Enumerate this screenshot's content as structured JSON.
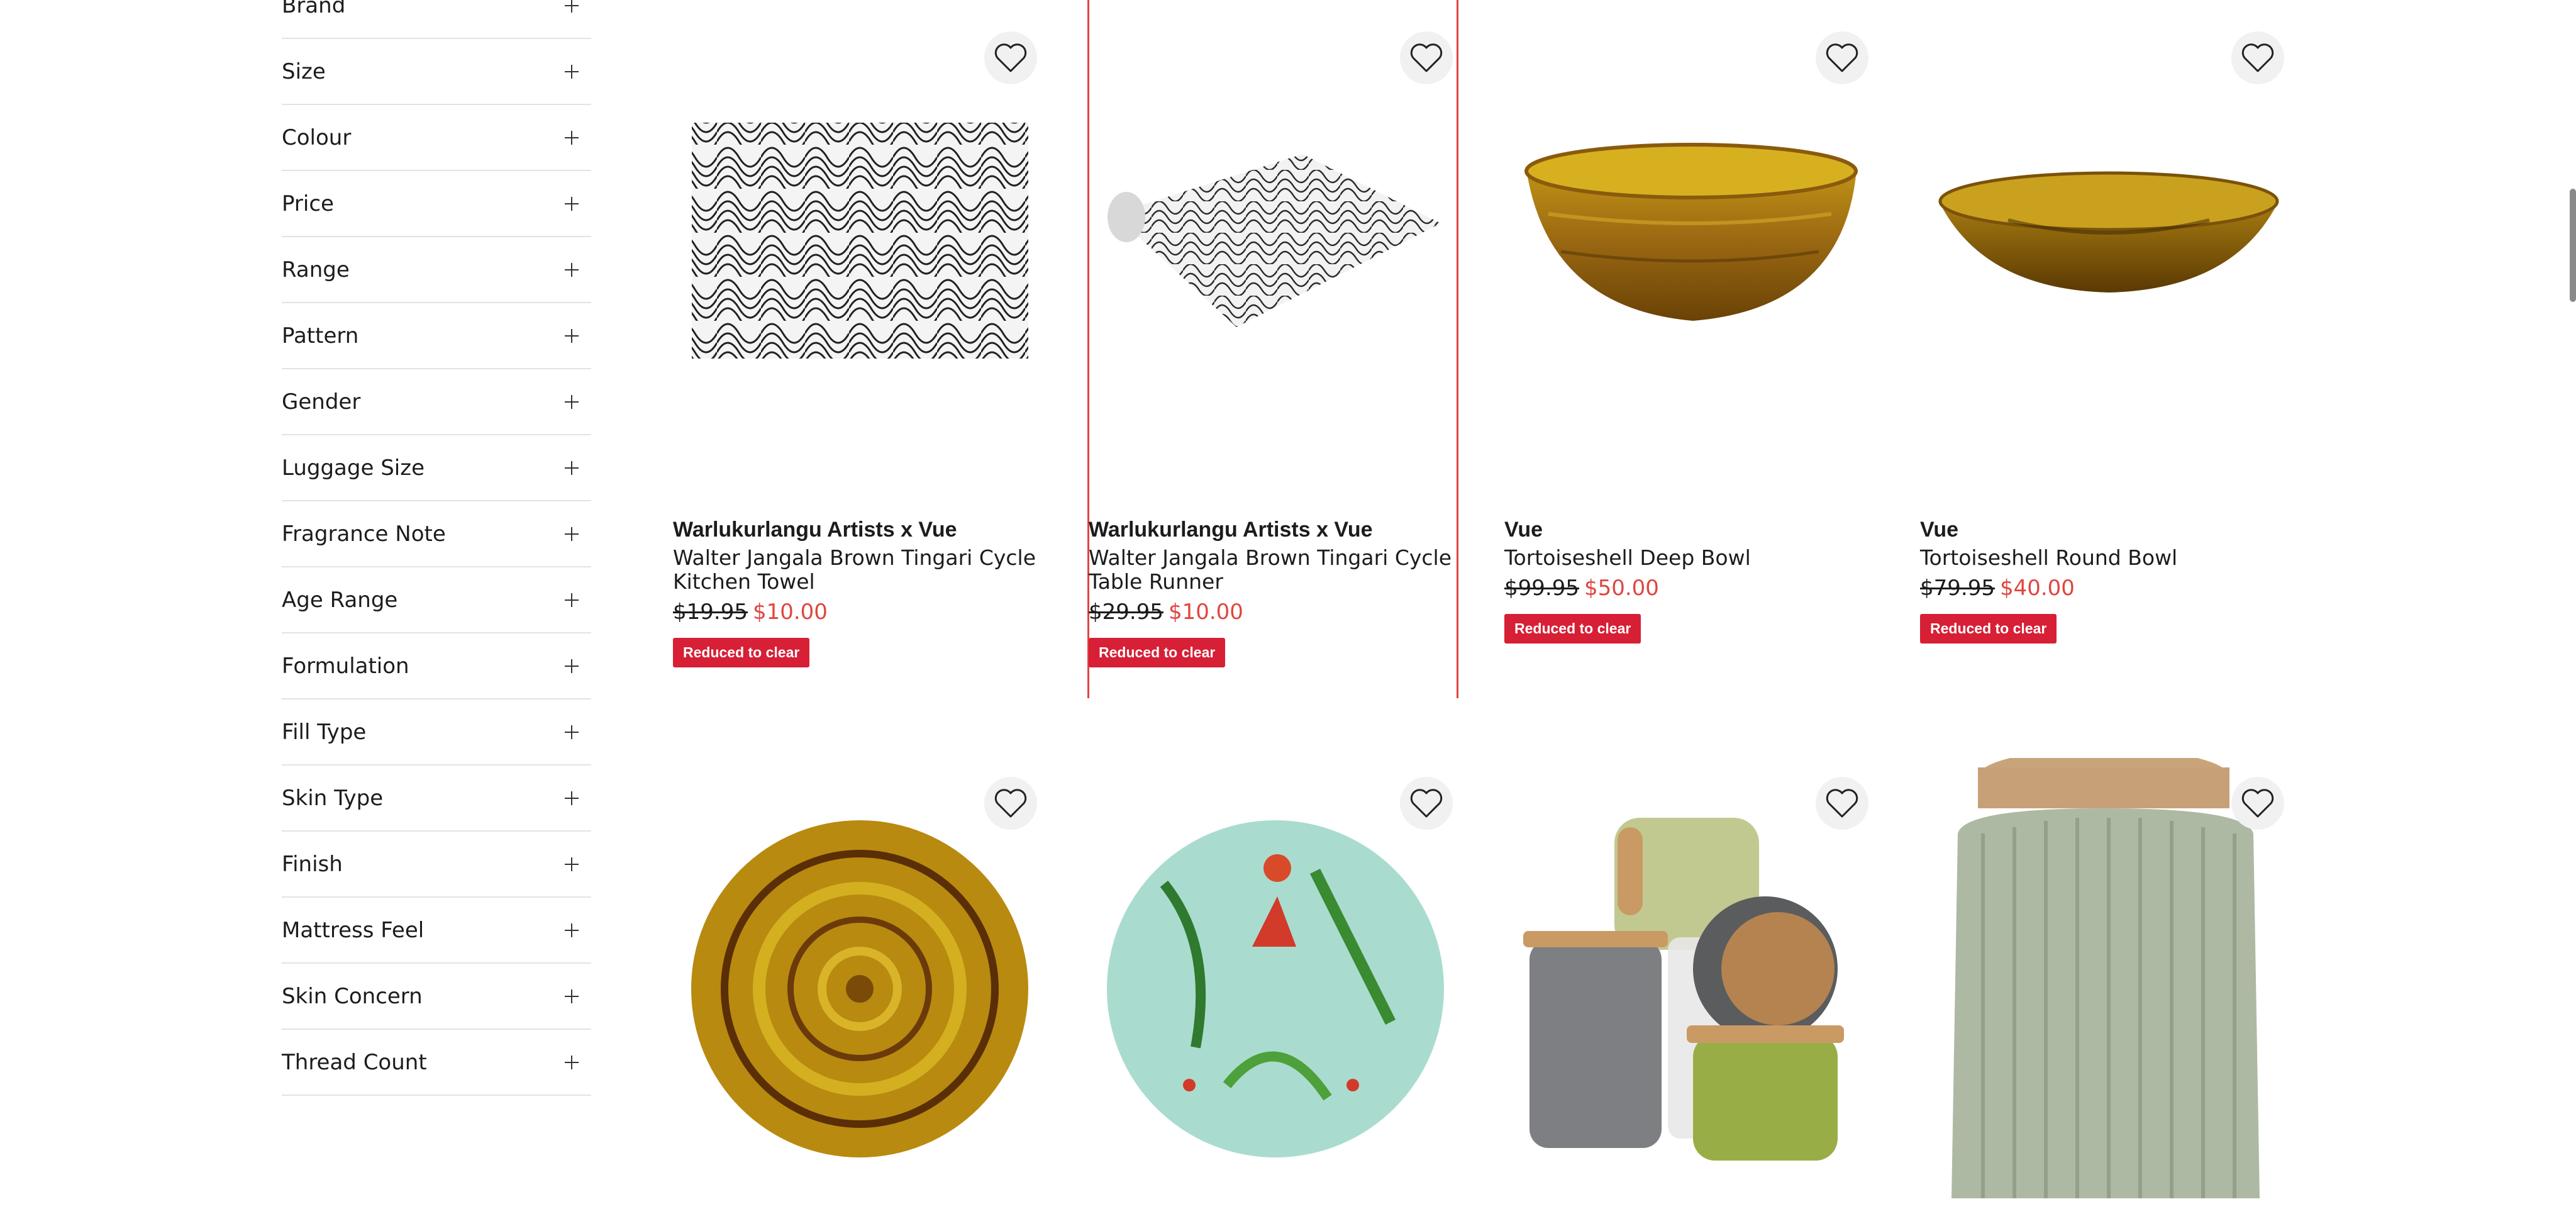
{
  "filters": [
    "Brand",
    "Size",
    "Colour",
    "Price",
    "Range",
    "Pattern",
    "Gender",
    "Luggage Size",
    "Fragrance Note",
    "Age Range",
    "Formulation",
    "Fill Type",
    "Skin Type",
    "Finish",
    "Mattress Feel",
    "Skin Concern",
    "Thread Count"
  ],
  "products": [
    {
      "brand": "Warlukurlangu Artists x Vue",
      "name": "Walter Jangala Brown Tingari Cycle Kitchen Towel",
      "was": "$19.95",
      "now": "$10.00",
      "badge": "Reduced to clear"
    },
    {
      "brand": "Warlukurlangu Artists x Vue",
      "name": "Walter Jangala Brown Tingari Cycle Table Runner",
      "was": "$29.95",
      "now": "$10.00",
      "badge": "Reduced to clear"
    },
    {
      "brand": "Vue",
      "name": "Tortoiseshell Deep Bowl",
      "was": "$99.95",
      "now": "$50.00",
      "badge": "Reduced to clear"
    },
    {
      "brand": "Vue",
      "name": "Tortoiseshell Round Bowl",
      "was": "$79.95",
      "now": "$40.00",
      "badge": "Reduced to clear"
    }
  ],
  "icons": {
    "wishlist": "heart-outline-icon",
    "expand": "plus-icon"
  },
  "colors": {
    "sale_price": "#e0453f",
    "badge_bg": "#d71f35",
    "selection_outline": "#e0453f"
  }
}
